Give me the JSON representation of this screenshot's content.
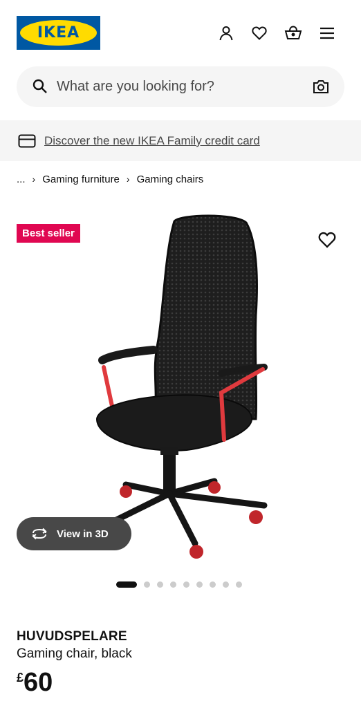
{
  "header": {
    "logo_text": "IKEA",
    "icons": [
      "account-icon",
      "heart-icon",
      "basket-icon",
      "menu-icon"
    ]
  },
  "search": {
    "placeholder": "What are you looking for?"
  },
  "promo": {
    "link_text": "Discover the new IKEA Family credit card"
  },
  "breadcrumb": {
    "ellipsis": "...",
    "items": [
      "Gaming furniture",
      "Gaming chairs"
    ]
  },
  "product": {
    "badge": "Best seller",
    "view3d_label": "View in 3D",
    "name": "HUVUDSPELARE",
    "description": "Gaming chair, black",
    "currency": "£",
    "price": "60",
    "image_count": 10,
    "active_image_index": 0
  },
  "colors": {
    "ikea_blue": "#0058a3",
    "ikea_yellow": "#ffdb00",
    "badge_red": "#e00751",
    "chair_accent": "#e03a3e"
  }
}
